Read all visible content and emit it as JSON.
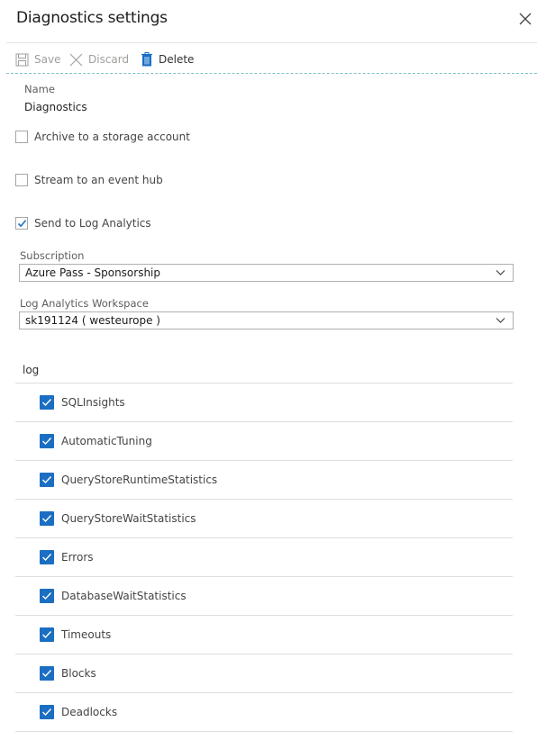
{
  "header": {
    "title": "Diagnostics settings",
    "close_icon": "close-icon"
  },
  "toolbar": {
    "save_label": "Save",
    "discard_label": "Discard",
    "delete_label": "Delete",
    "save_enabled": false,
    "discard_enabled": false,
    "delete_enabled": true
  },
  "form": {
    "name_label": "Name",
    "name_value": "Diagnostics",
    "archive": {
      "label": "Archive to a storage account",
      "checked": false
    },
    "stream": {
      "label": "Stream to an event hub",
      "checked": false
    },
    "log_analytics": {
      "label": "Send to Log Analytics",
      "checked": true
    },
    "subscription": {
      "label": "Subscription",
      "value": "Azure Pass - Sponsorship"
    },
    "workspace": {
      "label": "Log Analytics Workspace",
      "value": "sk191124 ( westeurope )"
    }
  },
  "log": {
    "header": "log",
    "items": [
      {
        "label": "SQLInsights",
        "checked": true
      },
      {
        "label": "AutomaticTuning",
        "checked": true
      },
      {
        "label": "QueryStoreRuntimeStatistics",
        "checked": true
      },
      {
        "label": "QueryStoreWaitStatistics",
        "checked": true
      },
      {
        "label": "Errors",
        "checked": true
      },
      {
        "label": "DatabaseWaitStatistics",
        "checked": true
      },
      {
        "label": "Timeouts",
        "checked": true
      },
      {
        "label": "Blocks",
        "checked": true
      },
      {
        "label": "Deadlocks",
        "checked": true
      }
    ]
  },
  "colors": {
    "accent": "#1b6ec2",
    "divider": "#dedede"
  }
}
